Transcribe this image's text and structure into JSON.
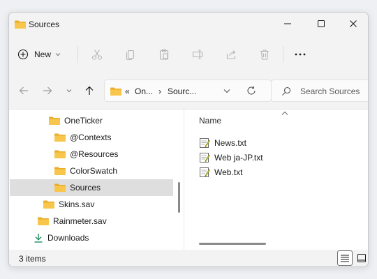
{
  "window": {
    "title": "Sources"
  },
  "toolbar": {
    "new_label": "New"
  },
  "address": {
    "ellipsis": "«",
    "crumb1": "On...",
    "crumb2": "Sourc..."
  },
  "search": {
    "placeholder": "Search Sources"
  },
  "tree": {
    "items": [
      {
        "label": "OneTicker",
        "kind": "folder"
      },
      {
        "label": "@Contexts",
        "kind": "folder"
      },
      {
        "label": "@Resources",
        "kind": "folder"
      },
      {
        "label": "ColorSwatch",
        "kind": "folder"
      },
      {
        "label": "Sources",
        "kind": "folder",
        "selected": true
      },
      {
        "label": "Skins.sav",
        "kind": "folder"
      },
      {
        "label": "Rainmeter.sav",
        "kind": "folder"
      },
      {
        "label": "Downloads",
        "kind": "downloads"
      }
    ]
  },
  "files": {
    "column_name": "Name",
    "items": [
      {
        "name": "News.txt",
        "icon": "text-file-icon"
      },
      {
        "name": "Web ja-JP.txt",
        "icon": "text-file-icon"
      },
      {
        "name": "Web.txt",
        "icon": "text-file-icon"
      }
    ]
  },
  "status": {
    "item_count": "3 items"
  },
  "colors": {
    "folder": "#f7c64b",
    "folder_dark": "#e9ad2a",
    "selection": "#dedede",
    "download": "#1f8f5f"
  }
}
